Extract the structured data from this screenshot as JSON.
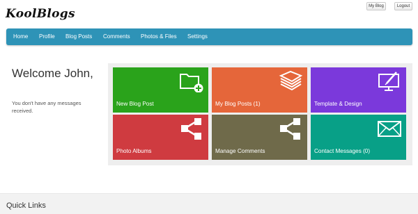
{
  "brand": {
    "logo": "KoolBlogs"
  },
  "top_buttons": {
    "my_blog": "My Blog",
    "logout": "Logout"
  },
  "nav": [
    "Home",
    "Profile",
    "Blog Posts",
    "Comments",
    "Photos & Files",
    "Settings"
  ],
  "welcome": {
    "title": "Welcome John,",
    "message": "You don't have any messages received."
  },
  "tiles": [
    {
      "label": "New Blog Post",
      "color": "#2aa31b",
      "icon": "folder-add-icon"
    },
    {
      "label": "My Blog Posts (1)",
      "color": "#e5663a",
      "icon": "layers-icon"
    },
    {
      "label": "Template & Design",
      "color": "#7b39db",
      "icon": "monitor-pen-icon"
    },
    {
      "label": "Photo Albums",
      "color": "#cf3b40",
      "icon": "share-icon"
    },
    {
      "label": "Manage Comments",
      "color": "#6f6a4a",
      "icon": "share-icon"
    },
    {
      "label": "Contact Messages (0)",
      "color": "#08a087",
      "icon": "envelope-icon"
    }
  ],
  "quick_links": {
    "title": "Quick Links"
  }
}
